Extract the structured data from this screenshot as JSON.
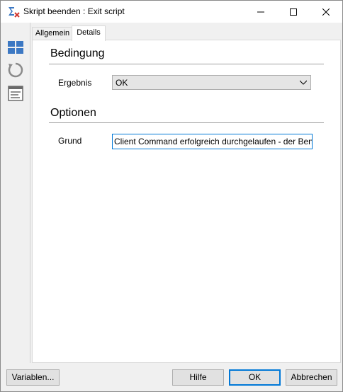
{
  "window": {
    "title": "Skript beenden : Exit script"
  },
  "icons": {
    "app": "script-exit-icon",
    "minimize": "minimize-icon",
    "maximize": "maximize-icon",
    "close": "close-icon",
    "sidebar": [
      "layout-grid-icon",
      "refresh-icon",
      "list-view-icon"
    ]
  },
  "tabs": [
    {
      "label": "Allgemein"
    },
    {
      "label": "Details",
      "active": true
    }
  ],
  "sections": {
    "condition": {
      "heading": "Bedingung",
      "result_label": "Ergebnis",
      "result_value": "OK"
    },
    "options": {
      "heading": "Optionen",
      "reason_label": "Grund",
      "reason_value": "Client Command erfolgreich durchgelaufen - der Benutzer"
    }
  },
  "buttons": {
    "variables": "Variablen...",
    "help": "Hilfe",
    "ok": "OK",
    "cancel": "Abbrechen"
  },
  "colors": {
    "accent": "#0078d7",
    "icon_blue": "#3c78c3"
  }
}
